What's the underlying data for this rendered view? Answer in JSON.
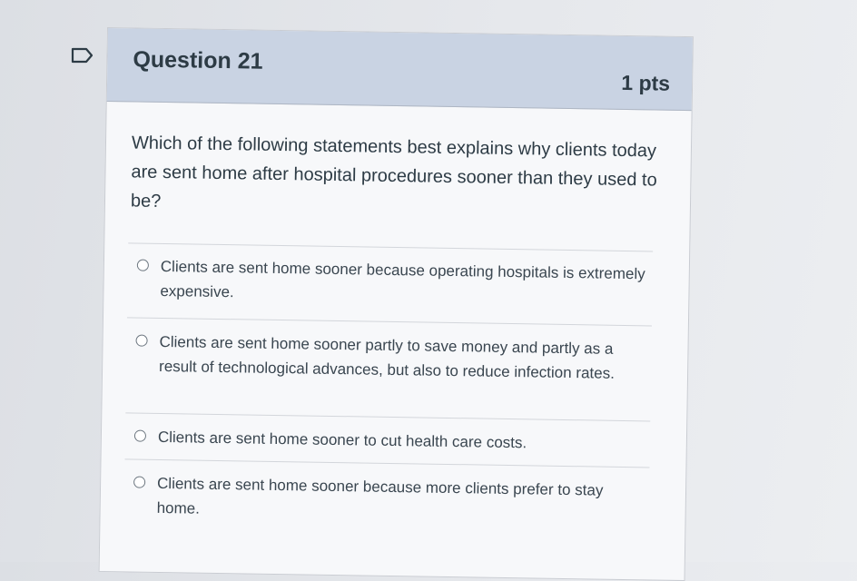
{
  "question": {
    "title": "Question 21",
    "points": "1 pts",
    "text": "Which of the following statements best explains why clients today are sent home after hospital procedures sooner than they used to be?"
  },
  "answers": [
    {
      "label": "Clients are sent home sooner because operating hospitals is extremely expensive."
    },
    {
      "label": "Clients are sent home sooner partly to save money and partly as a result of technological advances, but also to reduce infection rates."
    },
    {
      "label": "Clients are sent home sooner to cut health care costs."
    },
    {
      "label": "Clients are sent home sooner because more clients prefer to stay home."
    }
  ],
  "icons": {
    "flag": "bookmark-flag-icon",
    "radio": "radio-button-icon"
  },
  "colors": {
    "header_bg": "#c9d3e3",
    "text": "#2d3b45"
  }
}
